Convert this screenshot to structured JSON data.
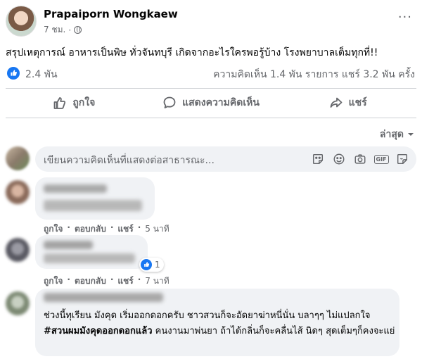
{
  "post": {
    "author": "Prapaiporn Wongkaew",
    "time": "7 ชม.",
    "separator": "·",
    "more": "···",
    "text": "สรุปเหตุการณ์ อาหารเป็นพิษ ทั่วจันทบุรี เกิดจากอะไรใครพอรู้บ้าง โรงพยาบาลเต็มทุกที่!!"
  },
  "reactions": {
    "like_count": "2.4 พัน",
    "stats": "ความคิดเห็น 1.4 พัน รายการ  แชร์ 3.2 พัน ครั้ง"
  },
  "actions": {
    "like": "ถูกใจ",
    "comment": "แสดงความคิดเห็น",
    "share": "แชร์"
  },
  "sort": {
    "label": "ล่าสุด",
    "icon": "caret-down-icon"
  },
  "composer": {
    "placeholder": "เขียนความคิดเห็นที่แสดงต่อสาธารณะ...",
    "icons": [
      "sticker-icon",
      "emoji-icon",
      "camera-icon",
      "gif-icon",
      "avatar-sticker-icon"
    ],
    "gif_label": "GIF"
  },
  "comments": [
    {
      "actions": {
        "like": "ถูกใจ",
        "reply": "ตอบกลับ",
        "share": "แชร์",
        "time": "5 นาที"
      }
    },
    {
      "reaction_count": "1",
      "actions": {
        "like": "ถูกใจ",
        "reply": "ตอบกลับ",
        "share": "แชร์",
        "time": "7 นาที"
      }
    },
    {
      "text_part1": "ช่วงนี้ทุเรียน มังคุด เริ่มออกดอกครับ ชาวสวนก็จะอัดยาฆ่าหนี่นั่น บลาๆๆ ไม่แปลกใจ ",
      "hashtag": "#สวนผมมังคุดออกดอกแล้ว",
      "text_part2": " คนงานมาพ่นยา ถ้าได้กลิ่นก็จะคลื่นไส้ นิดๆ สุดเต็มๆก็คงจะแย่"
    }
  ],
  "colors": {
    "accent": "#1877f2",
    "secondary_text": "#65676b",
    "bubble": "#f0f2f5"
  }
}
